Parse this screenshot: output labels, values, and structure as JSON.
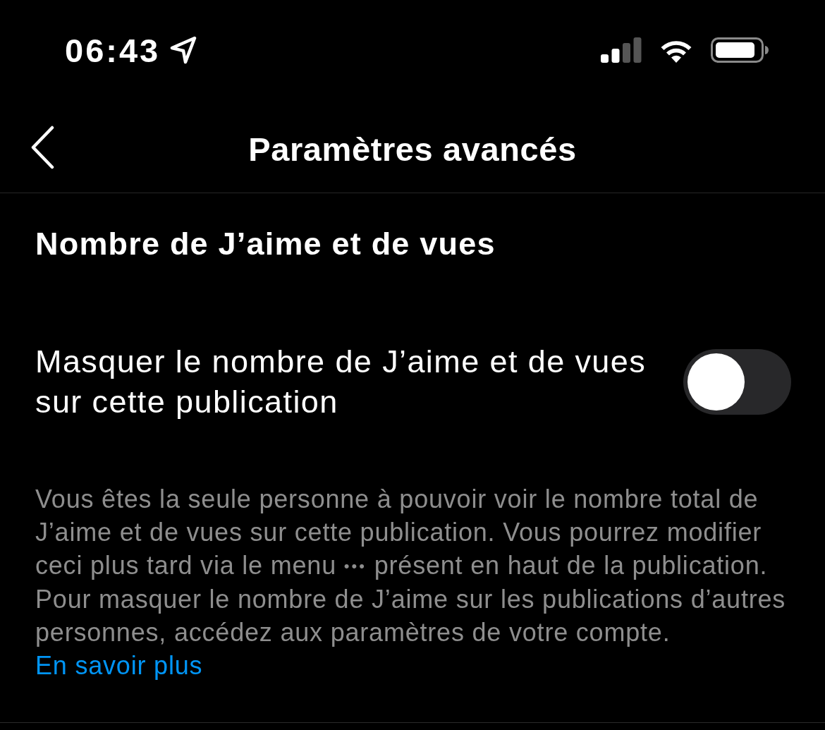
{
  "status_bar": {
    "time": "06:43"
  },
  "nav_bar": {
    "title": "Paramètres avancés"
  },
  "section": {
    "title": "Nombre de J’aime et de vues"
  },
  "setting": {
    "label": "Masquer le nombre de J’aime et de vues sur cette publication",
    "on": false
  },
  "help": [
    {
      "kind": "text",
      "text": "Vous êtes la seule personne à pouvoir voir le nombre total de J’aime et de vues sur cette publication. Vous pourrez modifier ceci plus tard via le menu"
    },
    {
      "kind": "glyph",
      "text": "•••"
    },
    {
      "kind": "text",
      "text": "présent en haut de la publication. Pour masquer le nombre de J’aime sur les publications d’autres personnes, accédez aux paramètres de votre compte."
    },
    {
      "kind": "link",
      "text": "En savoir plus"
    }
  ]
}
